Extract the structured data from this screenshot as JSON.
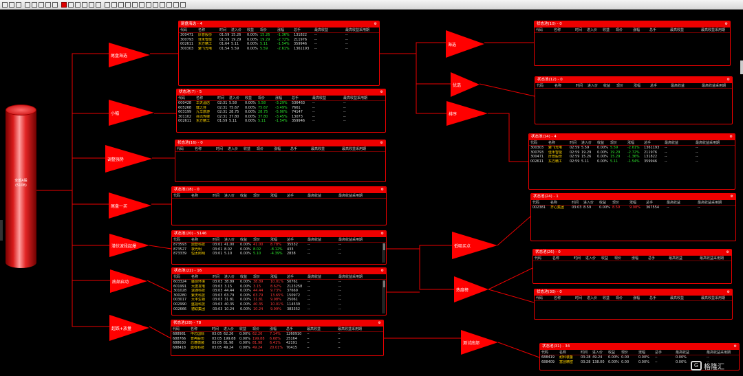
{
  "toolbar": {
    "icons": [
      "open-icon",
      "save-icon",
      "cut-icon",
      "undo-icon",
      "redo-icon",
      "find-icon",
      "grid-icon",
      "layout-icon",
      "pointer-icon",
      "circle-icon",
      "rect-icon",
      "text-icon",
      "arrow-icon",
      "line-icon",
      "arrow2-icon",
      "ellipse-icon",
      "rounded-rect-icon",
      "diamond-icon",
      "hexagon-icon",
      "curve-icon",
      "connector-icon",
      "align-icon",
      "zoom-icon",
      "settings-icon",
      "export-icon",
      "window-icon"
    ]
  },
  "source": {
    "label_line1": "全部A股",
    "label_line2": "(5108)"
  },
  "filters": [
    {
      "id": "f1",
      "label": "尾盘海选"
    },
    {
      "id": "f2",
      "label": "小幅"
    },
    {
      "id": "f3",
      "label": "调整强势"
    },
    {
      "id": "f4",
      "label": "尾盘一买"
    },
    {
      "id": "f5",
      "label": "潜伏波段起爆"
    },
    {
      "id": "f6",
      "label": "底部启动"
    },
    {
      "id": "f7",
      "label": "超跌+放量"
    },
    {
      "id": "f8",
      "label": "海选"
    },
    {
      "id": "f9",
      "label": "优选"
    },
    {
      "id": "f10",
      "label": "排序"
    },
    {
      "id": "f11",
      "label": "低吸买点"
    },
    {
      "id": "f12",
      "label": "热度榜"
    },
    {
      "id": "f13",
      "label": "测试底部"
    }
  ],
  "columns": [
    "代码",
    "名称",
    "时间",
    "进入价",
    "收益",
    "现价",
    "涨幅",
    "总手",
    "最高收益",
    "最高收益采用期"
  ],
  "pools": [
    {
      "id": "w1",
      "title": "尾盘海选 - 4",
      "rows": [
        [
          "300471",
          "厚普股份",
          "01:59",
          "15.26",
          "0.00%",
          "15.26",
          "-1.36%",
          "131822",
          "--",
          "--"
        ],
        [
          "300793",
          "佳禾智能",
          "01:59",
          "19.29",
          "0.00%",
          "19.29",
          "-2.72%",
          "211976",
          "--",
          "--"
        ],
        [
          "002611",
          "东方精工",
          "01:64",
          "5.11",
          "0.00%",
          "5.11",
          "-1.54%",
          "359946",
          "--",
          "--"
        ],
        [
          "300303",
          "聚飞光电",
          "01:54",
          "5.59",
          "0.00%",
          "5.59",
          "-2.61%",
          "1361193",
          "--",
          "--"
        ]
      ]
    },
    {
      "id": "w2",
      "title": "状态池(7) - 5",
      "rows": [
        [
          "000428",
          "华天酒店",
          "02:31",
          "5.58",
          "0.00%",
          "5.58",
          "-3.29%",
          "536463",
          "--",
          "--"
        ],
        [
          "605268",
          "健之佳",
          "02:31",
          "75.67",
          "0.00%",
          "75.67",
          "-3.49%",
          "7661",
          "--",
          "--"
        ],
        [
          "603199",
          "九华旅游",
          "02:31",
          "28.75",
          "0.00%",
          "28.75",
          "-5.90%",
          "74147",
          "--",
          "--"
        ],
        [
          "301102",
          "兆讯传媒",
          "02:31",
          "37.80",
          "0.00%",
          "37.80",
          "-3.45%",
          "13073",
          "--",
          "--"
        ],
        [
          "002611",
          "东方精工",
          "01:59",
          "5.11",
          "0.00%",
          "5.11",
          "-1.54%",
          "359946",
          "--",
          "--"
        ]
      ]
    },
    {
      "id": "w3",
      "title": "状态池(16) - 0",
      "rows": []
    },
    {
      "id": "w4",
      "title": "状态池(18) - 0",
      "rows": []
    },
    {
      "id": "w5",
      "title": "状态池(20) - 5146",
      "rows": [
        [
          "873593",
          "鼎智科技",
          "03:01",
          "41.00",
          "0.00%",
          "41.00",
          "8.78%",
          "35532",
          "--",
          "--"
        ],
        [
          "873527",
          "夜光明",
          "03:01",
          "8.02",
          "0.00%",
          "8.02",
          "-8.12%",
          "433",
          "--",
          "--"
        ],
        [
          "873339",
          "恒太照明",
          "03:01",
          "5.10",
          "0.00%",
          "5.10",
          "-4.39%",
          "2838",
          "--",
          "--"
        ]
      ]
    },
    {
      "id": "w6",
      "title": "状态池(22) - 16",
      "rows": [
        [
          "603324",
          "盛剑环境",
          "03:03",
          "38.89",
          "0.00%",
          "38.89",
          "10.01%",
          "50761",
          "--",
          "--"
        ],
        [
          "601991",
          "大唐发电",
          "03:03",
          "3.15",
          "0.00%",
          "3.15",
          "8.62%",
          "2123258",
          "--",
          "--"
        ],
        [
          "301028",
          "退通科技",
          "03:03",
          "44.44",
          "0.00%",
          "44.44",
          "9.73%",
          "37669",
          "--",
          "--"
        ],
        [
          "300280",
          "紫天科技",
          "03:03",
          "63.79",
          "0.00%",
          "63.79",
          "13.65%",
          "150972",
          "--",
          "--"
        ],
        [
          "003017",
          "大丰生物",
          "03:03",
          "31.81",
          "0.00%",
          "31.81",
          "9.98%",
          "25061",
          "--",
          "--"
        ],
        [
          "002990",
          "盛视科技",
          "03:03",
          "40.35",
          "0.00%",
          "40.35",
          "10.01%",
          "114539",
          "--",
          "--"
        ],
        [
          "002666",
          "德联集团",
          "03:03",
          "10.24",
          "0.00%",
          "10.24",
          "9.99%",
          "383352",
          "--",
          "--"
        ]
      ]
    },
    {
      "id": "w7",
      "title": "状态池(28) - 78",
      "rows": [
        [
          "688981",
          "中芯国际",
          "03:05",
          "62.26",
          "0.00%",
          "62.26",
          "7.14%",
          "1260910",
          "--",
          "--"
        ],
        [
          "688766",
          "普冉股份",
          "03:05",
          "199.88",
          "0.00%",
          "199.88",
          "6.68%",
          "25164",
          "--",
          "--"
        ],
        [
          "688630",
          "芯碁微装",
          "03:05",
          "81.98",
          "0.00%",
          "81.98",
          "6.41%",
          "42191",
          "--",
          "--"
        ],
        [
          "688418",
          "震有科技",
          "03:05",
          "49.24",
          "0.00%",
          "49.24",
          "20.01%",
          "70415",
          "--",
          "--"
        ]
      ]
    },
    {
      "id": "w8",
      "title": "状态池(10) - 0",
      "rows": []
    },
    {
      "id": "w9",
      "title": "状态池(12) - 0",
      "rows": []
    },
    {
      "id": "w10",
      "title": "状态池(14) - 4",
      "rows": [
        [
          "300303",
          "聚飞光电",
          "02:59",
          "5.59",
          "0.00%",
          "5.59",
          "-2.61%",
          "1361193",
          "--",
          "--"
        ],
        [
          "300793",
          "佳禾智能",
          "02:59",
          "19.29",
          "0.00%",
          "19.29",
          "-2.72%",
          "211976",
          "--",
          "--"
        ],
        [
          "300471",
          "厚普股份",
          "02:59",
          "15.26",
          "0.00%",
          "15.29",
          "-1.36%",
          "131822",
          "--",
          "--"
        ],
        [
          "002611",
          "东方精工",
          "02:59",
          "5.11",
          "0.00%",
          "5.11",
          "-1.54%",
          "359946",
          "--",
          "--"
        ]
      ]
    },
    {
      "id": "w11",
      "title": "状态池(24) - 1",
      "rows": [
        [
          "002381",
          "齐心集团",
          "03:03",
          "8.59",
          "0.00%",
          "8.59",
          "9.98%",
          "367554",
          "--",
          "--"
        ]
      ]
    },
    {
      "id": "w12",
      "title": "状态池(26) - 0",
      "rows": []
    },
    {
      "id": "w13",
      "title": "状态池(30) - 0",
      "rows": []
    },
    {
      "id": "w14",
      "title": "状态池(31) - 34",
      "rows": [
        [
          "688419",
          "耐科装备",
          "03:28",
          "49.24",
          "0.00%",
          "0.00",
          "0.00%",
          "--",
          "0.00%",
          "--"
        ],
        [
          "688409",
          "富创精密",
          "03:28",
          "138.00",
          "0.00%",
          "0.00",
          "0.00%",
          "--",
          "0.00%",
          "--"
        ]
      ]
    }
  ],
  "watermark": {
    "text": "格隆汇",
    "logo": "G"
  }
}
